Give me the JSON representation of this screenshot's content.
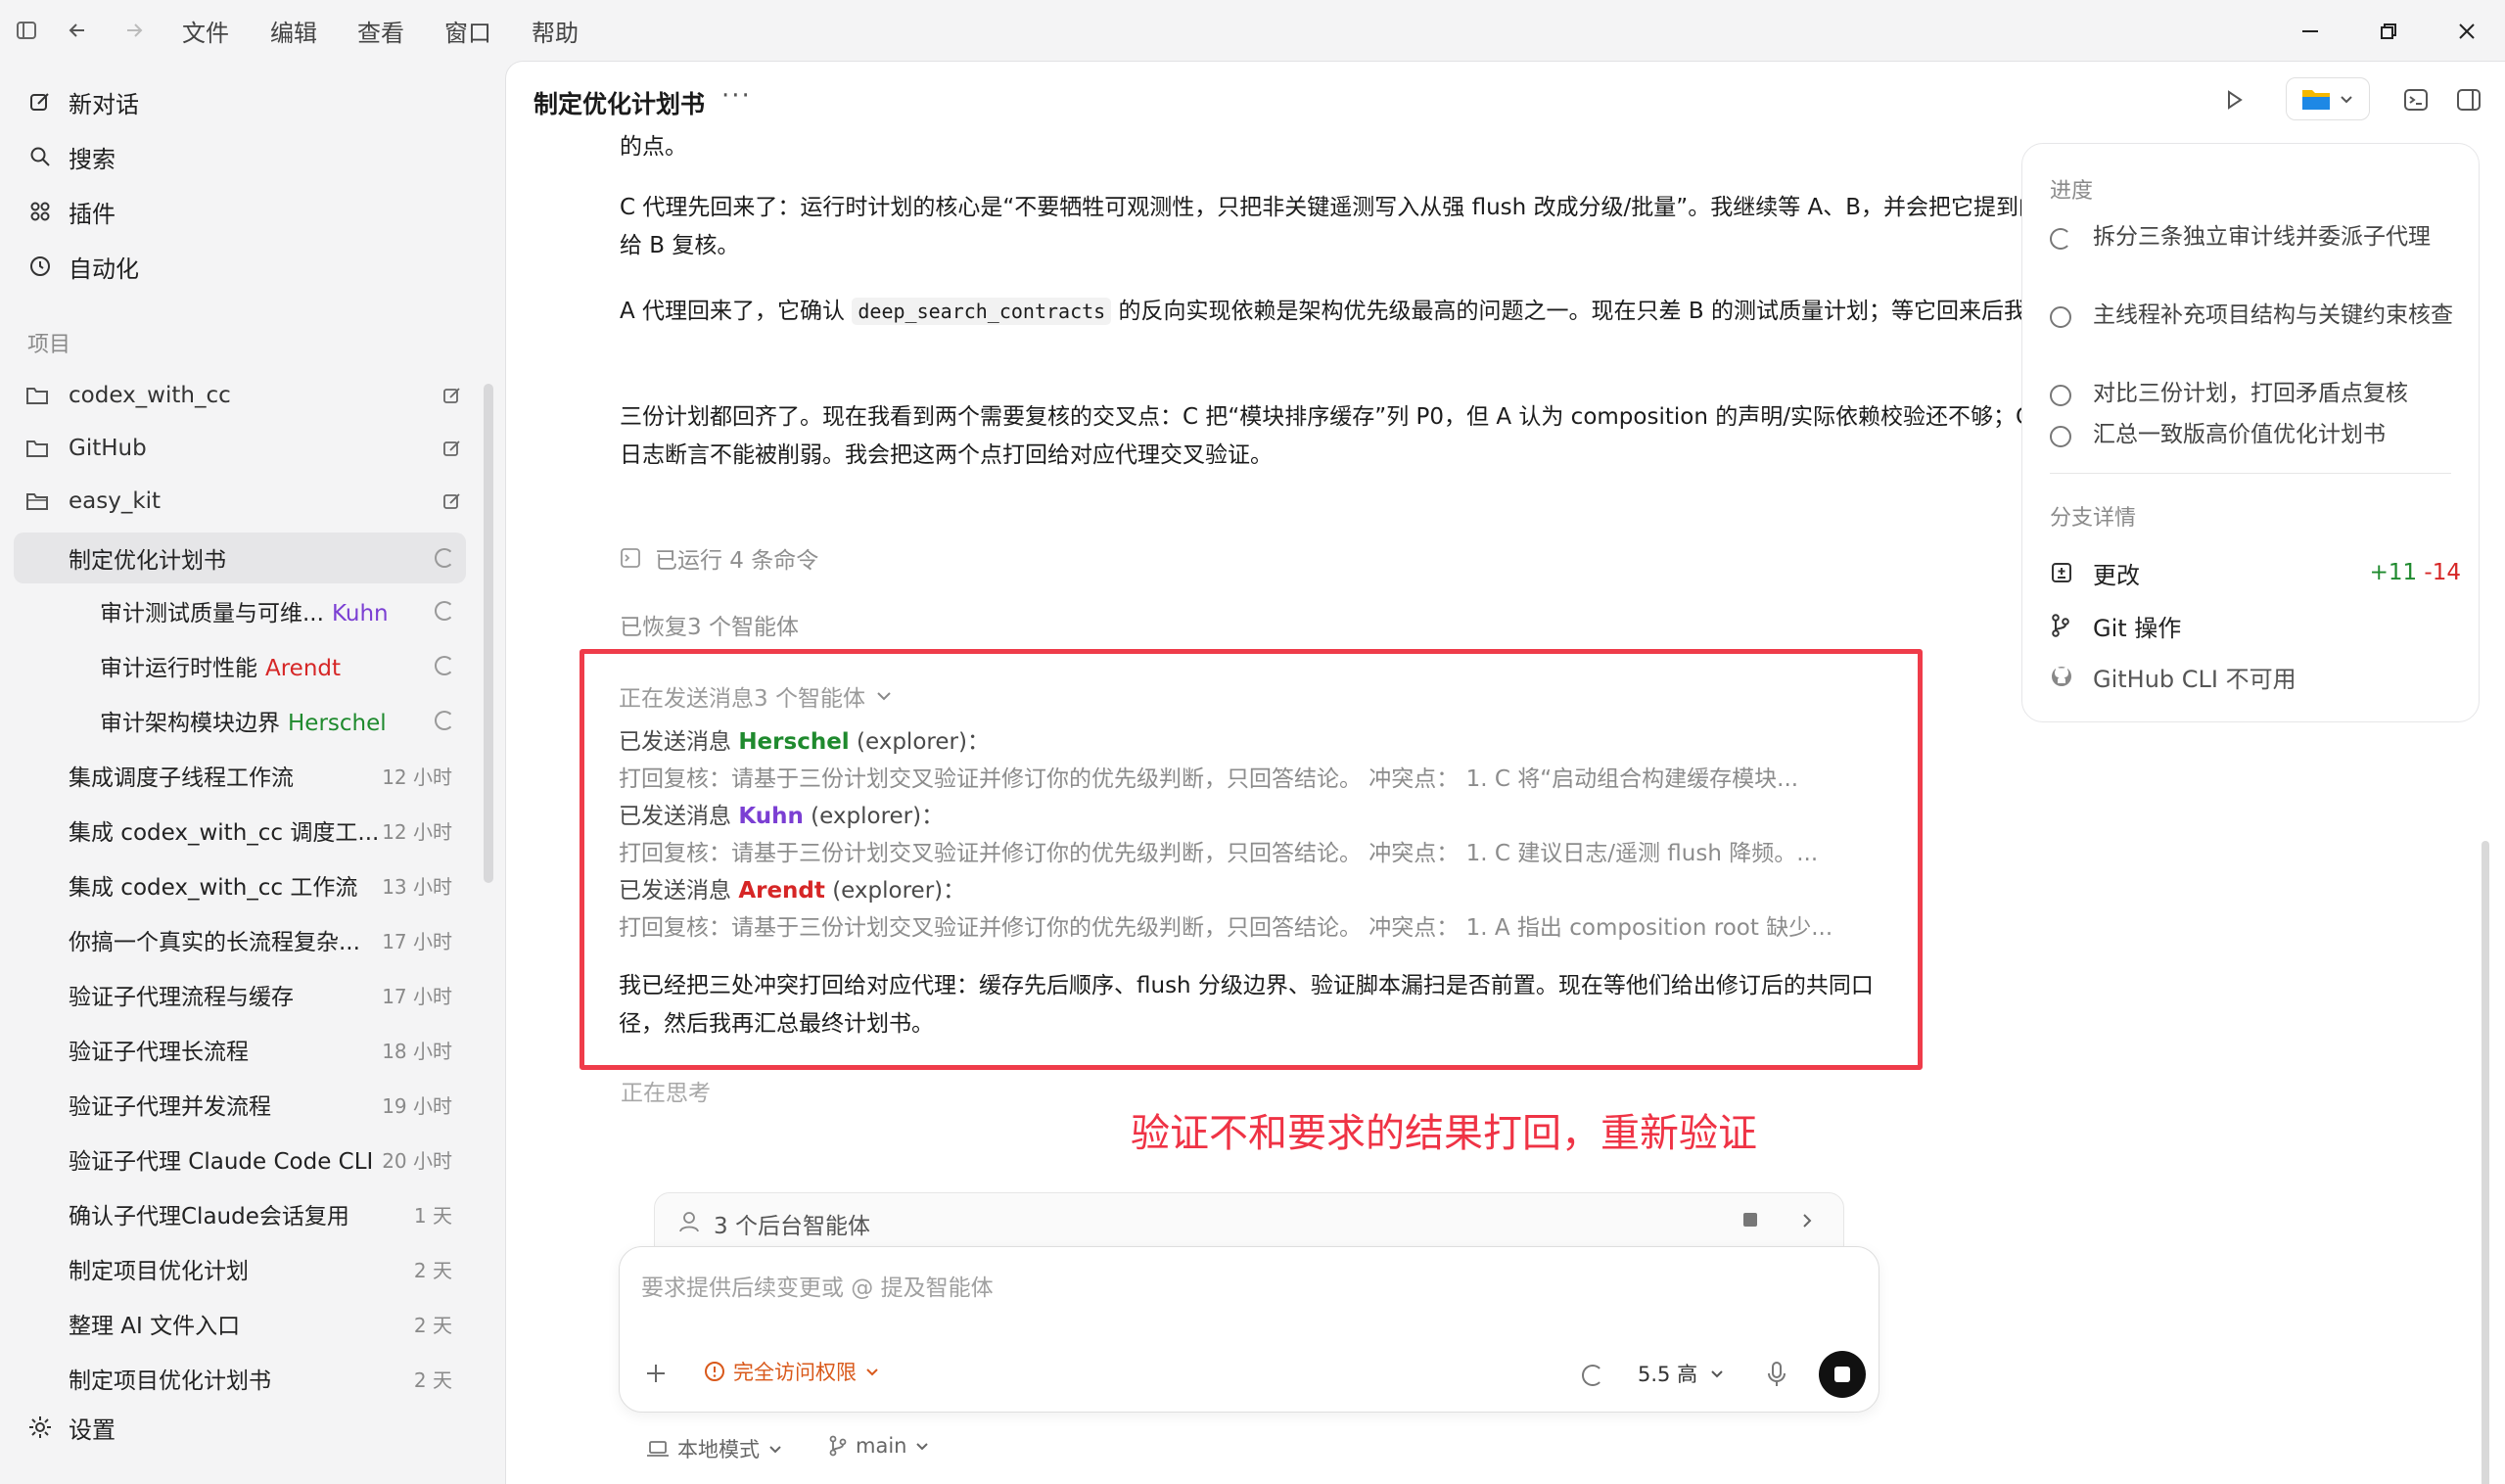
{
  "menu": [
    "文件",
    "编辑",
    "查看",
    "窗口",
    "帮助"
  ],
  "sidebar": {
    "nav": [
      {
        "label": "新对话",
        "icon": "pencil-square-icon"
      },
      {
        "label": "搜索",
        "icon": "search-icon"
      },
      {
        "label": "插件",
        "icon": "plugin-grid-icon"
      },
      {
        "label": "自动化",
        "icon": "clock-icon"
      }
    ],
    "section_label": "项目",
    "projects": [
      "codex_with_cc",
      "GitHub",
      "easy_kit"
    ],
    "active_thread": "制定优化计划书",
    "sub_threads": [
      {
        "label": "审计测试质量与可维...",
        "agent": "Kuhn",
        "color": "purple"
      },
      {
        "label": "审计运行时性能",
        "agent": "Arendt",
        "color": "red"
      },
      {
        "label": "审计架构模块边界",
        "agent": "Herschel",
        "color": "green"
      }
    ],
    "threads": [
      {
        "label": "集成调度子线程工作流",
        "time": "12 小时"
      },
      {
        "label": "集成 codex_with_cc 调度工...",
        "time": "12 小时"
      },
      {
        "label": "集成 codex_with_cc 工作流",
        "time": "13 小时"
      },
      {
        "label": "你搞一个真实的长流程复杂...",
        "time": "17 小时"
      },
      {
        "label": "验证子代理流程与缓存",
        "time": "17 小时"
      },
      {
        "label": "验证子代理长流程",
        "time": "18 小时"
      },
      {
        "label": "验证子代理并发流程",
        "time": "19 小时"
      },
      {
        "label": "验证子代理 Claude Code CLI",
        "time": "20 小时"
      },
      {
        "label": "确认子代理Claude会话复用",
        "time": "1 天"
      },
      {
        "label": "制定项目优化计划",
        "time": "2 天"
      },
      {
        "label": "整理 AI 文件入口",
        "time": "2 天"
      },
      {
        "label": "制定项目优化计划书",
        "time": "2 天"
      }
    ],
    "settings": "设置"
  },
  "main": {
    "title": "制定优化计划书",
    "more": "···",
    "cut_text": "的点。",
    "para1": "C 代理先回来了：运行时计划的核心是“不要牺牲可观测性，只把非关键遥测写入从强 flush 改成分级/批量”。我继续等 A、B，并会把它提到的 flush 降频与测试稳定性冲突点交给 B 复核。",
    "para2_a": "A 代理回来了，它确认 ",
    "para2_code": "deep_search_contracts",
    "para2_b": " 的反向实现依赖是架构优先级最高的问题之一。现在只差 B 的测试质量计划；等它回来后我会把 A/C 的冲突点统一打回复核。",
    "para3": "三份计划都回齐了。现在我看到两个需要复核的交叉点：C 把“模块排序缓存”列 P0，但 A 认为 composition 的声明/实际依赖校验还不够；C 要降频写盘，B 强调测试稳定性和日志断言不能被削弱。我会把这两个点打回给对应代理交叉验证。",
    "ran_commands": "已运行 4 条命令",
    "restored": "已恢复3 个智能体",
    "sending_header": "正在发送消息3 个智能体",
    "messages": [
      {
        "prefix": "已发送消息 ",
        "agent": "Herschel",
        "role": " (explorer)：",
        "color": "green",
        "body": "打回复核：请基于三份计划交叉验证并修订你的优先级判断，只回答结论。 冲突点： 1. C 将“启动组合构建缓存模块..."
      },
      {
        "prefix": "已发送消息 ",
        "agent": "Kuhn",
        "role": " (explorer)：",
        "color": "purple",
        "body": "打回复核：请基于三份计划交叉验证并修订你的优先级判断，只回答结论。 冲突点： 1. C 建议日志/遥测 flush 降频。..."
      },
      {
        "prefix": "已发送消息 ",
        "agent": "Arendt",
        "role": " (explorer)：",
        "color": "red",
        "body": "打回复核：请基于三份计划交叉验证并修订你的优先级判断，只回答结论。 冲突点： 1. A 指出 composition root 缺少..."
      }
    ],
    "summary": "我已经把三处冲突打回给对应代理：缓存先后顺序、flush 分级边界、验证脚本漏扫是否前置。现在等他们给出修订后的共同口径，然后我再汇总最终计划书。",
    "thinking": "正在思考",
    "annotation": "验证不和要求的结果打回，重新验证"
  },
  "composer": {
    "bg_agents": "3 个后台智能体",
    "placeholder": "要求提供后续变更或 @ 提及智能体",
    "access": "完全访问权限",
    "model": "5.5 高",
    "mode": "本地模式",
    "branch": "main"
  },
  "right_panel": {
    "progress_label": "进度",
    "progress": [
      {
        "text": "拆分三条独立审计线并委派子代理",
        "status": "running"
      },
      {
        "text": "主线程补充项目结构与关键约束核查",
        "status": "pending"
      },
      {
        "text": "对比三份计划，打回矛盾点复核",
        "status": "pending"
      },
      {
        "text": "汇总一致版高价值优化计划书",
        "status": "pending"
      }
    ],
    "branch_label": "分支详情",
    "changes": "更改",
    "diff_add": "+11",
    "diff_del": "-14",
    "git_ops": "Git 操作",
    "gh_cli": "GitHub CLI 不可用"
  },
  "colors": {
    "accent_red": "#ef3c4a",
    "agent_green": "#1f8a2e",
    "agent_purple": "#7b3fd3",
    "agent_red": "#d62626",
    "warn_orange": "#d9591b"
  }
}
